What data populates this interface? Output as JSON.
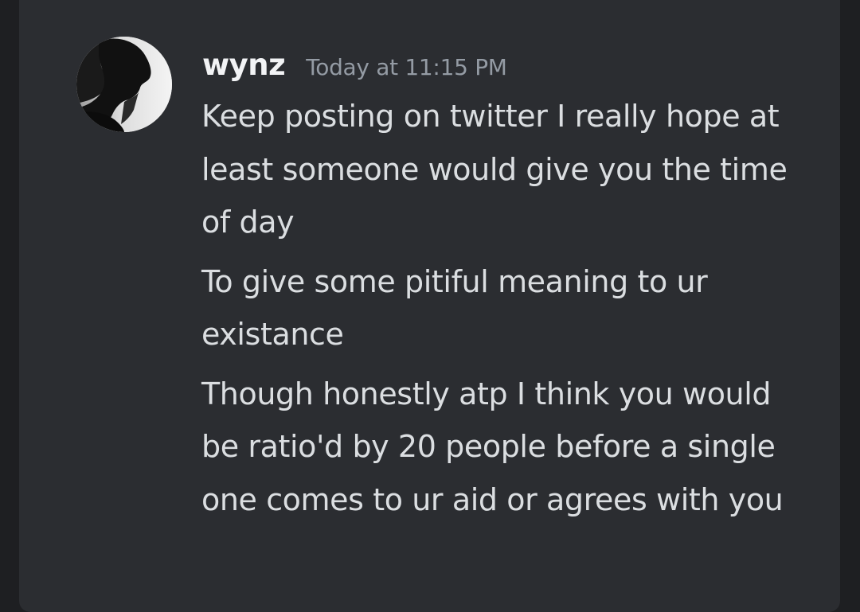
{
  "author": {
    "username": "wynz",
    "timestamp": "Today at 11:15 PM",
    "avatar_icon": "user-avatar-silhouette"
  },
  "messages": [
    {
      "text": "Keep posting on twitter I really hope at least someone would give you the time of day"
    },
    {
      "text": "To give some pitiful meaning to ur existance"
    },
    {
      "text": "Though honestly atp I think you would be ratio'd by 20 people before a single one comes to ur aid or agrees with you"
    }
  ],
  "colors": {
    "background": "#1e1f22",
    "panel": "#2b2d31",
    "username": "#f2f3f5",
    "timestamp": "#949ba4",
    "message_text": "#dbdee1"
  }
}
